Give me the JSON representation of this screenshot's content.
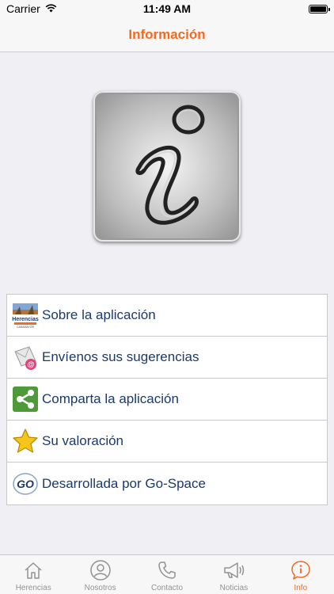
{
  "status_bar": {
    "carrier": "Carrier",
    "time": "11:49 AM"
  },
  "nav": {
    "title": "Información"
  },
  "menu": {
    "items": [
      {
        "label": "Sobre la aplicación",
        "icon": "herencias-logo-icon"
      },
      {
        "label": "Envíenos sus sugerencias",
        "icon": "mail-at-icon"
      },
      {
        "label": "Comparta la aplicación",
        "icon": "share-icon"
      },
      {
        "label": "Su valoración",
        "icon": "star-icon"
      },
      {
        "label": "Desarrollada por Go-Space",
        "icon": "go-space-logo-icon"
      }
    ],
    "logo_text": "Herencias",
    "logo_subtext": "CASAMAYOR",
    "go_logo_text": "GO"
  },
  "tabs": [
    {
      "label": "Herencias",
      "icon": "home-icon",
      "active": false
    },
    {
      "label": "Nosotros",
      "icon": "person-icon",
      "active": false
    },
    {
      "label": "Contacto",
      "icon": "phone-icon",
      "active": false
    },
    {
      "label": "Noticias",
      "icon": "megaphone-icon",
      "active": false
    },
    {
      "label": "Info",
      "icon": "info-icon",
      "active": true
    }
  ],
  "colors": {
    "accent": "#f26a21",
    "label_blue": "#1a3a6b",
    "tab_inactive": "#929292"
  }
}
